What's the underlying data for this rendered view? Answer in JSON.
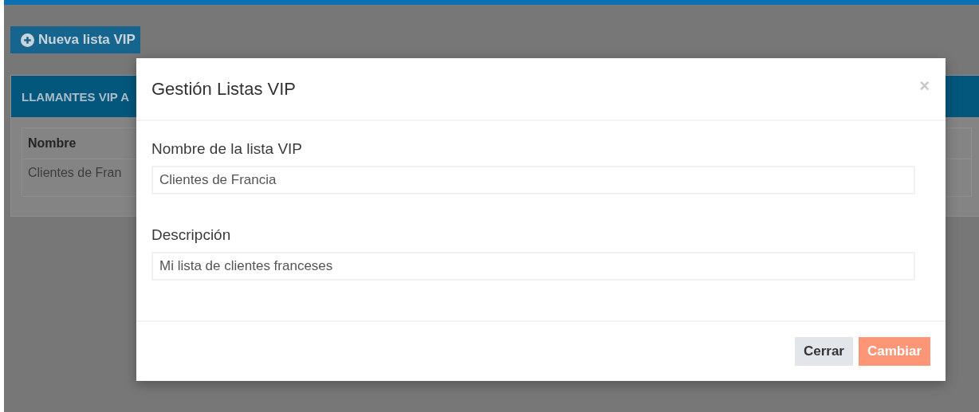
{
  "page": {
    "new_button": {
      "label": "Nueva lista VIP"
    },
    "panel": {
      "title": "LLAMANTES VIP A",
      "table": {
        "columns": [
          "Nombre"
        ],
        "rows": [
          [
            "Clientes de Fran"
          ]
        ]
      }
    }
  },
  "modal": {
    "title": "Gestión Listas VIP",
    "close": "×",
    "fields": [
      {
        "label": "Nombre de la lista VIP",
        "value": "Clientes de Francia"
      },
      {
        "label": "Descripción",
        "value": "Mi lista de clientes franceses"
      }
    ],
    "buttons": [
      {
        "label": "Cerrar",
        "kind": "secondary"
      },
      {
        "label": "Cambiar",
        "kind": "primary"
      }
    ]
  }
}
